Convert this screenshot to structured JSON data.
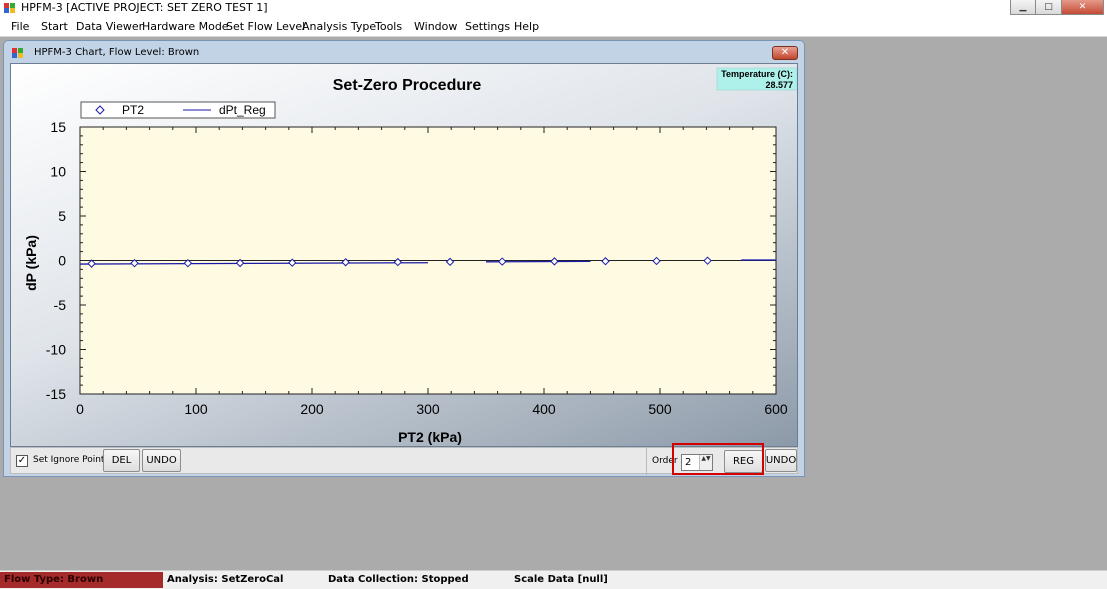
{
  "app": {
    "title": "HPFM-3  [ACTIVE PROJECT: SET ZERO TEST 1]",
    "window_buttons": {
      "minimize": "▁",
      "maximize": "□",
      "close": "✕"
    }
  },
  "menu": [
    "File",
    "Start",
    "Data Viewer",
    "Hardware Mode",
    "Set Flow Level",
    "Analysis Type",
    "Tools",
    "Window",
    "Settings",
    "Help"
  ],
  "child_window": {
    "title": "HPFM-3 Chart,  Flow Level: Brown",
    "close_glyph": "✕"
  },
  "temperature": {
    "label": "Temperature (C):",
    "value": "28.577"
  },
  "chart_data": {
    "type": "scatter",
    "title": "Set-Zero Procedure",
    "xlabel": "PT2 (kPa)",
    "ylabel": "dP (kPa)",
    "xlim": [
      0,
      600
    ],
    "ylim": [
      -15,
      15
    ],
    "xticks": [
      "0",
      "100",
      "200",
      "300",
      "400",
      "500",
      "600"
    ],
    "yticks": [
      "15",
      "10",
      "5",
      "0",
      "-5",
      "-10",
      "-15"
    ],
    "legend_position": "top-left",
    "plot_background": "#fffbe2",
    "series": [
      {
        "name": "PT2",
        "marker": "diamond",
        "color": "#1a1aa8",
        "x": [
          10,
          47,
          93,
          138,
          183,
          229,
          274,
          319,
          364,
          409,
          453,
          497,
          541
        ],
        "y": [
          -0.35,
          -0.3,
          -0.3,
          -0.28,
          -0.25,
          -0.2,
          -0.18,
          -0.15,
          -0.12,
          -0.1,
          -0.08,
          -0.05,
          -0.02
        ]
      },
      {
        "name": "dPt_Reg",
        "marker": "line",
        "color": "#1a1aa8",
        "x": [
          0,
          300,
          350,
          440,
          570,
          600
        ],
        "y": [
          -0.4,
          -0.25,
          -0.15,
          -0.1,
          0.05,
          0.05
        ],
        "gaps": [
          [
            300,
            350
          ],
          [
            440,
            570
          ]
        ]
      }
    ]
  },
  "bottom_left": {
    "checkbox_label": "Set Ignore Points",
    "checkbox_checked": "✓",
    "del_label": "DEL",
    "undo_label": "UNDO"
  },
  "bottom_right": {
    "order_label": "Order",
    "order_value": "2",
    "spinner_arrows": "▲▼",
    "reg_label": "REG",
    "undo_label": "UNDO"
  },
  "statusbar": {
    "flow_type": "Flow Type: Brown",
    "analysis": "Analysis: SetZeroCal",
    "data_collection": "Data Collection: Stopped",
    "scale_data": "Scale Data  [null]"
  },
  "colors": {
    "flow_status": "#a52a2a",
    "temperature_bg": "#aef0ea",
    "highlight": "#d40000"
  }
}
